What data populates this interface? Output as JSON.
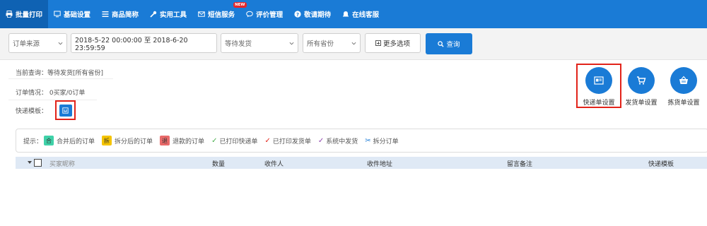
{
  "nav": {
    "items": [
      {
        "label": "批量打印",
        "icon": "printer-icon"
      },
      {
        "label": "基础设置",
        "icon": "monitor-icon"
      },
      {
        "label": "商品简称",
        "icon": "list-icon"
      },
      {
        "label": "实用工具",
        "icon": "wrench-icon"
      },
      {
        "label": "短信服务",
        "icon": "mail-icon",
        "badge": "NEW"
      },
      {
        "label": "评价管理",
        "icon": "chat-icon"
      },
      {
        "label": "敬请期待",
        "icon": "question-icon"
      },
      {
        "label": "在线客服",
        "icon": "bell-icon"
      }
    ]
  },
  "filters": {
    "order_source": "订单来源",
    "date_range": "2018-5-22 00:00:00 至 2018-6-20 23:59:59",
    "status": "等待发货",
    "province": "所有省份",
    "more_options": "更多选项",
    "query": "查询"
  },
  "info": {
    "current_query": "当前查询：等待发货[所有省份]",
    "order_status": "订单情况： 0买家/0订单",
    "express_template": "快递模板："
  },
  "tools": [
    {
      "label": "快递单设置",
      "icon": "waybill-icon"
    },
    {
      "label": "发货单设置",
      "icon": "cart-icon"
    },
    {
      "label": "拣货单设置",
      "icon": "basket-icon"
    }
  ],
  "tips": {
    "prefix": "提示：",
    "items": [
      {
        "label": "合并后的订单",
        "mark": "合",
        "color": "#3fd1a8"
      },
      {
        "label": "拆分后的订单",
        "mark": "拆",
        "color": "#f5c400"
      },
      {
        "label": "退款的订单",
        "mark": "退",
        "color": "#e96a6a"
      },
      {
        "label": "已打印快递单",
        "mark": "✓",
        "color": "#4caf50"
      },
      {
        "label": "已打印发货单",
        "mark": "✓",
        "color": "#e2231a"
      },
      {
        "label": "系统中发货",
        "mark": "✓",
        "color": "#8e44ad"
      },
      {
        "label": "拆分订单",
        "mark": "✂",
        "color": "#1a7bd6"
      }
    ]
  },
  "table": {
    "columns": [
      "买家昵称",
      "数量",
      "收件人",
      "收件地址",
      "留言备注",
      "快递模板"
    ]
  }
}
